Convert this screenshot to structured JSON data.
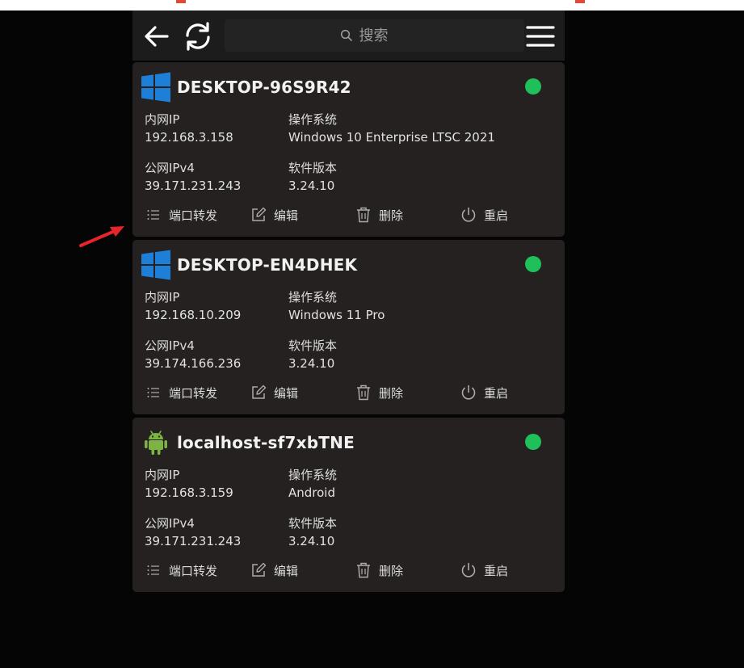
{
  "toolbar": {
    "back_icon": "arrow-left-icon",
    "refresh_icon": "refresh-icon",
    "search_placeholder": "搜索",
    "menu_icon": "hamburger-menu-icon"
  },
  "labels": {
    "lan_ip": "内网IP",
    "os": "操作系统",
    "wan_ip": "公网IPv4",
    "version": "软件版本"
  },
  "actions": {
    "port_forward": "端口转发",
    "edit": "编辑",
    "delete": "删除",
    "reboot": "重启"
  },
  "devices": [
    {
      "name": "DESKTOP-96S9R42",
      "platform": "windows-icon",
      "online": true,
      "lan_ip": "192.168.3.158",
      "os": "Windows 10 Enterprise LTSC 2021",
      "wan_ip": "39.171.231.243",
      "version": "3.24.10"
    },
    {
      "name": "DESKTOP-EN4DHEK",
      "platform": "windows-icon",
      "online": true,
      "lan_ip": "192.168.10.209",
      "os": "Windows 11 Pro",
      "wan_ip": "39.174.166.236",
      "version": "3.24.10"
    },
    {
      "name": "localhost-sf7xbTNE",
      "platform": "android-icon",
      "online": true,
      "lan_ip": "192.168.3.159",
      "os": "Android",
      "wan_ip": "39.171.231.243",
      "version": "3.24.10"
    }
  ],
  "colors": {
    "online": "#1fc05a",
    "windows_blue": "#1e7fd8",
    "android_green": "#7cb342",
    "annotation_arrow": "#e5252a"
  }
}
